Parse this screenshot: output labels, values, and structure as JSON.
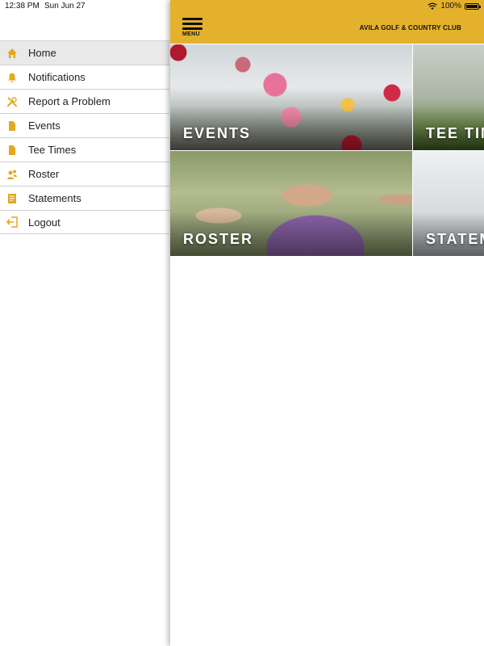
{
  "status_bar": {
    "time": "12:38 PM",
    "date": "Sun Jun 27",
    "battery": "100%"
  },
  "sidebar": {
    "items": [
      {
        "label": "Home",
        "icon": "home-icon",
        "active": true
      },
      {
        "label": "Notifications",
        "icon": "bell-icon",
        "active": false
      },
      {
        "label": "Report a Problem",
        "icon": "tools-icon",
        "active": false
      },
      {
        "label": "Events",
        "icon": "document-icon",
        "active": false
      },
      {
        "label": "Tee Times",
        "icon": "document-icon",
        "active": false
      },
      {
        "label": "Roster",
        "icon": "people-icon",
        "active": false
      },
      {
        "label": "Statements",
        "icon": "statement-icon",
        "active": false
      },
      {
        "label": "Logout",
        "icon": "logout-icon",
        "active": false
      }
    ],
    "icon_color": "#e3a81f"
  },
  "header": {
    "menu_label": "MENU",
    "title": "AVILA GOLF & COUNTRY CLUB",
    "background_color": "#e3b12b"
  },
  "tiles": {
    "events": "EVENTS",
    "tee_times": "TEE TIMES",
    "roster": "ROSTER",
    "statements": "STATEMENTS"
  }
}
